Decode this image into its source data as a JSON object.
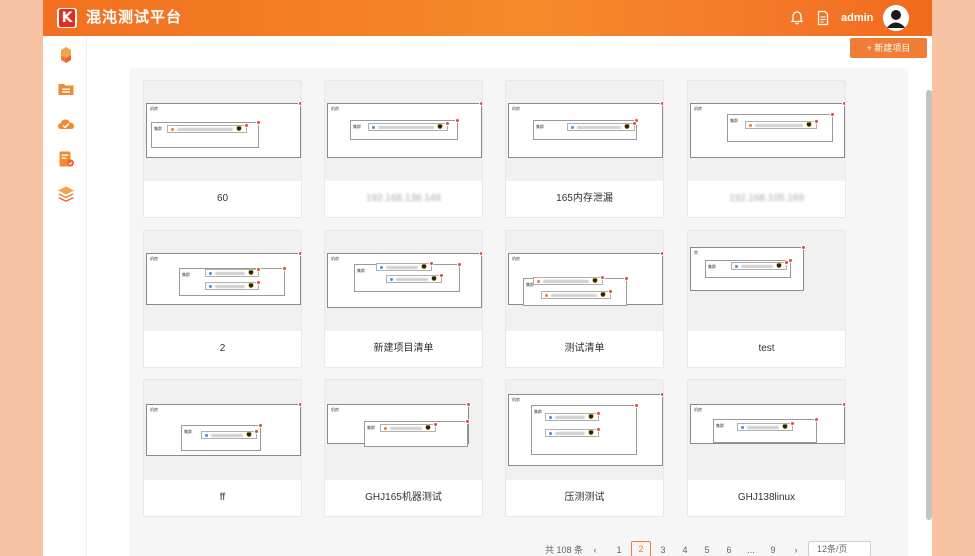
{
  "app": {
    "title": "混沌测试平台",
    "logo_letter": "K",
    "username": "admin",
    "brand_color": "#f26a1c"
  },
  "header": {
    "icons": [
      "bell-icon",
      "document-icon"
    ]
  },
  "sidebar": {
    "items": [
      {
        "name": "cube-icon"
      },
      {
        "name": "folder-icon"
      },
      {
        "name": "cloud-check-icon"
      },
      {
        "name": "report-icon"
      },
      {
        "name": "layers-icon"
      }
    ]
  },
  "toolbar": {
    "new_project_label": "+ 新建项目"
  },
  "cards": [
    {
      "label": "60",
      "blurred": false,
      "diagram_tags": [
        "机房",
        "集群"
      ]
    },
    {
      "label": "192.168.136.148",
      "blurred": true,
      "diagram_tags": [
        "机房",
        "集群"
      ]
    },
    {
      "label": "165内存泄漏",
      "blurred": false,
      "diagram_tags": [
        "机房",
        "集群"
      ]
    },
    {
      "label": "192.168.105.169",
      "blurred": true,
      "diagram_tags": [
        "机房",
        "集群"
      ]
    },
    {
      "label": "2",
      "blurred": false,
      "diagram_tags": [
        "机房",
        "集群"
      ]
    },
    {
      "label": "新建项目清单",
      "blurred": false,
      "diagram_tags": [
        "机房",
        "集群"
      ]
    },
    {
      "label": "测试清单",
      "blurred": false,
      "diagram_tags": [
        "机房",
        "集群"
      ]
    },
    {
      "label": "test",
      "blurred": false,
      "diagram_tags": [
        "房",
        "集群"
      ]
    },
    {
      "label": "ff",
      "blurred": false,
      "diagram_tags": [
        "机房",
        "集群"
      ]
    },
    {
      "label": "GHJ165机器测试",
      "blurred": false,
      "diagram_tags": [
        "机房",
        "集群"
      ]
    },
    {
      "label": "压测测试",
      "blurred": false,
      "diagram_tags": [
        "机房",
        "集群"
      ]
    },
    {
      "label": "GHJ138linux",
      "blurred": false,
      "diagram_tags": [
        "机房",
        "集群"
      ]
    }
  ],
  "pagination": {
    "total_label": "共 108 条",
    "prev": "‹",
    "next": "›",
    "pages": [
      "1",
      "2",
      "3",
      "4",
      "5",
      "6",
      "...",
      "9"
    ],
    "current_page": "2",
    "page_size": "12条/页"
  }
}
